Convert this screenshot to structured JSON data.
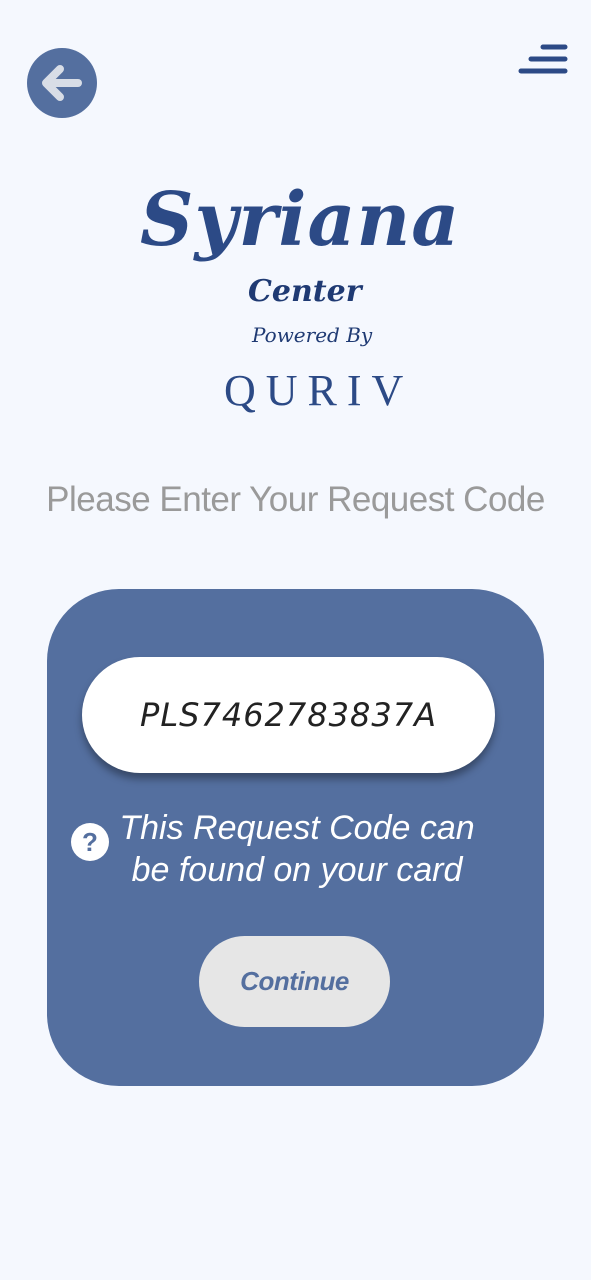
{
  "header": {
    "back_icon": "arrow-left-icon",
    "menu_icon": "menu-icon"
  },
  "logo": {
    "main": "Syriana",
    "sub": "Center",
    "powered": "Powered By",
    "partner": "QURIV"
  },
  "prompt": "Please Enter Your Request Code",
  "form": {
    "code_value": "PLS7462783837A",
    "help_icon": "?",
    "help_line1": "This Request Code can",
    "help_line2": "be found on your card",
    "continue_label": "Continue"
  },
  "colors": {
    "background": "#f5f8fe",
    "card": "#546f9f",
    "brand": "#2c4a86",
    "prompt_text": "#9a9a9a",
    "button_bg": "#e6e6e6"
  }
}
